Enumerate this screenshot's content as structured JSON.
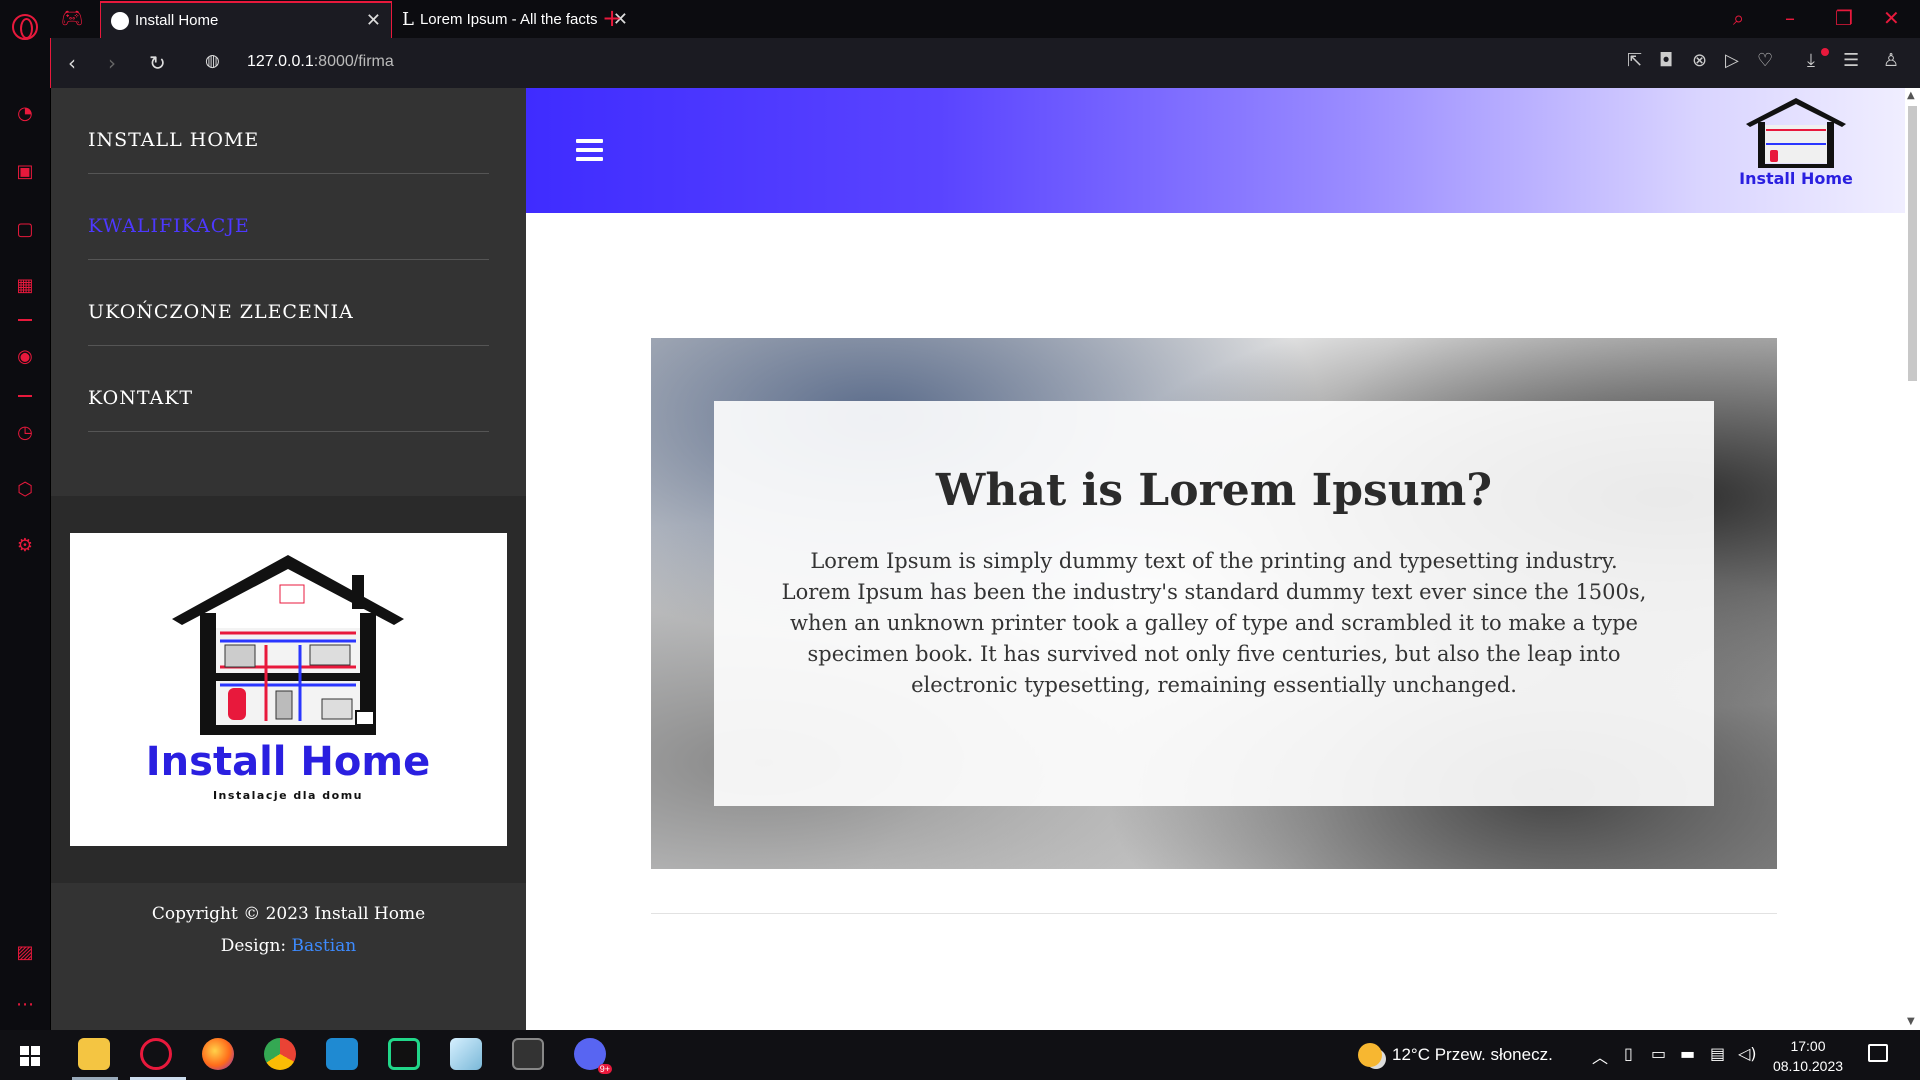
{
  "browser": {
    "tabs": [
      {
        "title": "Install Home"
      },
      {
        "title": "Lorem Ipsum - All the facts"
      }
    ],
    "url_host": "127.0.0.1",
    "url_rest": ":8000/firma"
  },
  "site": {
    "menu": [
      {
        "label": "INSTALL HOME"
      },
      {
        "label": "KWALIFIKACJE"
      },
      {
        "label": "UKOŃCZONE ZLECENIA"
      },
      {
        "label": "KONTAKT"
      }
    ],
    "logo": {
      "brand": "Install Home",
      "tagline": "Instalacje dla domu"
    },
    "footer": {
      "copyright": "Copyright © 2023 Install Home",
      "design_label": "Design:",
      "designer": "Bastian"
    },
    "banner": {
      "title": "What is Lorem Ipsum?",
      "text": "Lorem Ipsum is simply dummy text of the printing and typesetting industry. Lorem Ipsum has been the industry's standard dummy text ever since the 1500s, when an unknown printer took a galley of type and scrambled it to make a type specimen book. It has survived not only five centuries, but also the leap into electronic typesetting, remaining essentially unchanged."
    },
    "colors": {
      "accent": "#4d38ff",
      "browser_accent": "#e8193c"
    }
  },
  "taskbar": {
    "weather": "12°C  Przew. słonecz.",
    "time": "17:00",
    "date": "08.10.2023",
    "badge": "9+"
  }
}
